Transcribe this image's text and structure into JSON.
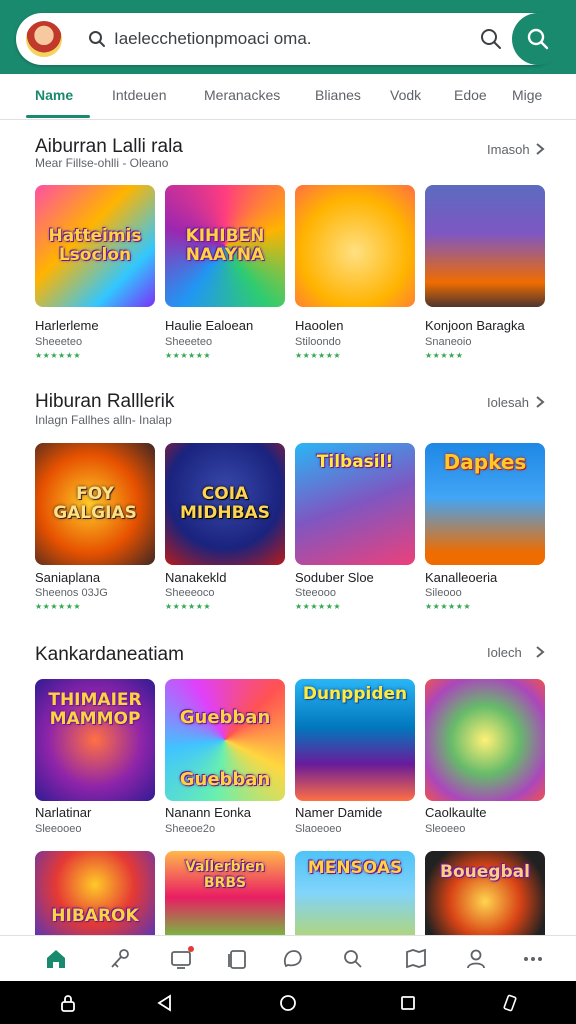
{
  "search": {
    "text": "Iaelecchetionpmoaci oma."
  },
  "tabs": [
    "Name",
    "Intdeuen",
    "Meranackes",
    "Blianes",
    "Vodk",
    "Edoe",
    "Mige"
  ],
  "sections": [
    {
      "title": "Aiburran Lalli rala",
      "subtitle": "Mear Fillse-ohlli - Oleano",
      "more": "Imasoh",
      "apps": [
        {
          "thumb": "Hatteimis Lsoclon",
          "name": "Harlerleme",
          "meta": "Sheeeteo",
          "stars": "★★★★★★"
        },
        {
          "thumb": "KIHIBEN NAAYNA",
          "name": "Haulie Ealoean",
          "meta": "Sheeeteo",
          "stars": "★★★★★★"
        },
        {
          "thumb": "",
          "name": "Haoolen",
          "meta": "Stiloondo",
          "stars": "★★★★★★"
        },
        {
          "thumb": "",
          "name": "Konjoon Baragka",
          "meta": "Snaneoio",
          "stars": "★★★★★"
        }
      ]
    },
    {
      "title": "Hiburan Ralllerik",
      "subtitle": "Inlagn Fallhes alln- Inalap",
      "more": "Iolesah",
      "apps": [
        {
          "thumb": "FOY GALGIAS",
          "name": "Saniaplana",
          "meta": "Sheenos 03JG",
          "stars": "★★★★★★"
        },
        {
          "thumb": "COIA MIDHBAS",
          "name": "Nanakekld",
          "meta": "Sheeeoco",
          "stars": "★★★★★★"
        },
        {
          "thumb": "Tilbasil!",
          "name": "Soduber Sloe",
          "meta": "Steeooo",
          "stars": "★★★★★★"
        },
        {
          "thumb": "Dapkes",
          "name": "Kanalleoeria",
          "meta": "Sileooo",
          "stars": "★★★★★★"
        }
      ]
    },
    {
      "title": "Kankardaneatiam",
      "subtitle": "",
      "more": "Iolech",
      "apps": [
        {
          "thumb": "THIMAIER MAMMOP",
          "name": "Narlatinar",
          "meta": "Sleeooeo",
          "stars": ""
        },
        {
          "thumb": "Guebban Guebban",
          "name": "Nanann Eonka",
          "meta": "Sheeoe2o",
          "stars": ""
        },
        {
          "thumb": "Dunppiden",
          "name": "Namer Damide",
          "meta": "Slaoeoeo",
          "stars": ""
        },
        {
          "thumb": "",
          "name": "Caolkaulte",
          "meta": "Sleoeeo",
          "stars": ""
        }
      ]
    },
    {
      "apps": [
        {
          "thumb": "HIBAROK"
        },
        {
          "thumb": "Vallerbien BRBS"
        },
        {
          "thumb": "MENSOAS"
        },
        {
          "thumb": "Bouegbal"
        }
      ]
    }
  ],
  "colors": {
    "accent": "#1a8a6e",
    "stars": "#34a853"
  }
}
